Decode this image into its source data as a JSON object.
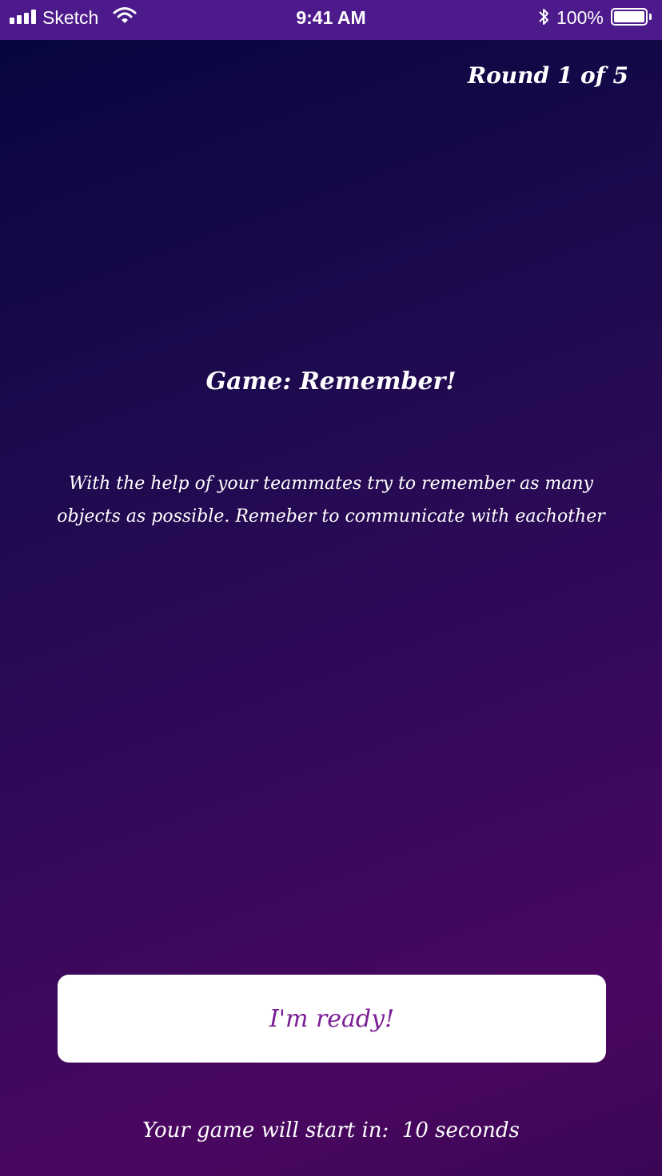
{
  "status_bar": {
    "carrier": "Sketch",
    "time": "9:41 AM",
    "battery_percent": "100%",
    "icons": [
      "signal-icon",
      "wifi-icon",
      "bluetooth-icon",
      "battery-icon"
    ]
  },
  "header": {
    "round_label": "Round 1 of 5"
  },
  "game": {
    "title": "Game: Remember!",
    "description": "With the help of your teammates try to remember as many objects as possible. Remeber to communicate with eachother"
  },
  "ready_button": {
    "label": "I'm ready!"
  },
  "countdown": {
    "text": "Your game will start in:  10 seconds"
  },
  "colors": {
    "status_bar": "#4d1a8c",
    "background_top": "#05053d",
    "background_bottom": "#4a0760",
    "button_text": "#7a1e96",
    "button_bg": "#ffffff"
  }
}
